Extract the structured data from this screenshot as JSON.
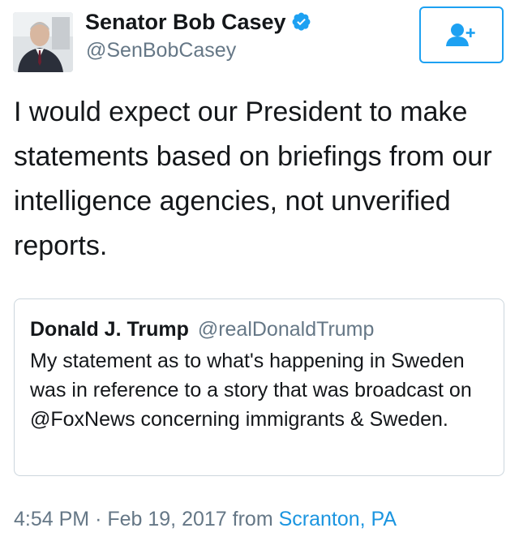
{
  "tweet": {
    "author": {
      "display_name": "Senator Bob Casey",
      "screen_name": "@SenBobCasey",
      "verified_icon": "verified-badge-icon",
      "avatar_icon": "profile-photo"
    },
    "follow_button": {
      "icon": "follow-person-plus-icon"
    },
    "text": "I would expect our President to make statements based on briefings from our intelligence agencies, not unverified reports.",
    "quoted_tweet": {
      "display_name": "Donald J. Trump",
      "screen_name": "@realDonaldTrump",
      "text": "My statement as to what's happening in Sweden was in reference to a story that was broadcast on @FoxNews concerning immigrants & Sweden."
    },
    "meta": {
      "time": "4:54 PM",
      "separator": "·",
      "date": "Feb 19, 2017",
      "from_label": "from",
      "location": "Scranton, PA"
    }
  },
  "colors": {
    "accent": "#1da1f2",
    "link": "#1b95e0",
    "secondary_text": "#657786",
    "border": "#ccd6dd"
  }
}
